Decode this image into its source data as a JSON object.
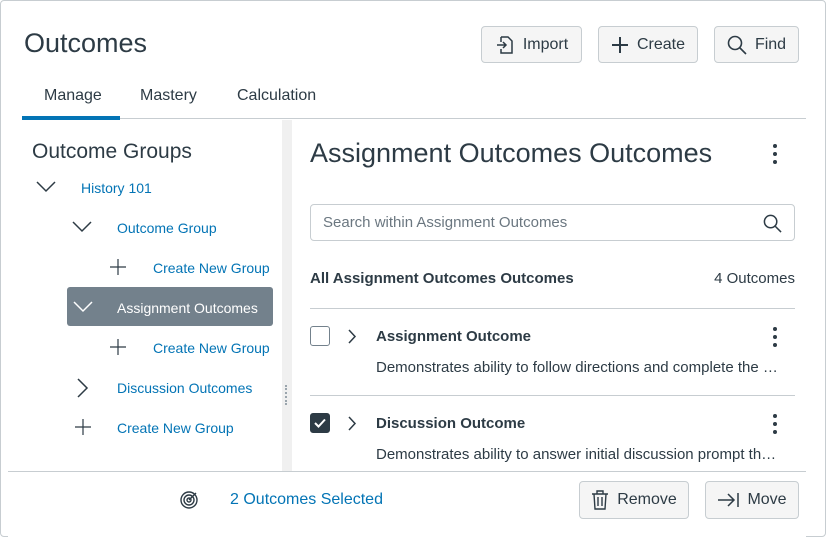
{
  "header": {
    "title": "Outcomes",
    "import_label": "Import",
    "create_label": "Create",
    "find_label": "Find"
  },
  "tabs": [
    {
      "label": "Manage",
      "active": true
    },
    {
      "label": "Mastery"
    },
    {
      "label": "Calculation"
    }
  ],
  "sidebar": {
    "title": "Outcome Groups",
    "tree": [
      {
        "label": "History 101"
      },
      {
        "label": "Outcome Group"
      },
      {
        "label": "Create New Group"
      },
      {
        "label": "Assignment Outcomes",
        "selected": true
      },
      {
        "label": "Create New Group"
      },
      {
        "label": "Discussion Outcomes"
      },
      {
        "label": "Create New Group"
      }
    ]
  },
  "main": {
    "title": "Assignment Outcomes Outcomes",
    "search_placeholder": "Search within Assignment Outcomes",
    "list_heading": "All Assignment Outcomes Outcomes",
    "count": "4 Outcomes",
    "items": [
      {
        "title": "Assignment Outcome",
        "description": "Demonstrates ability to follow directions and complete the assignment",
        "checked": false
      },
      {
        "title": "Discussion Outcome",
        "description": "Demonstrates ability to answer initial discussion prompt thoroughly",
        "checked": true
      }
    ]
  },
  "footer": {
    "selected": "2 Outcomes Selected",
    "remove_label": "Remove",
    "move_label": "Move"
  },
  "colors": {
    "accent": "#0374B5",
    "text": "#2D3B45",
    "selected_bg": "#73818C"
  }
}
